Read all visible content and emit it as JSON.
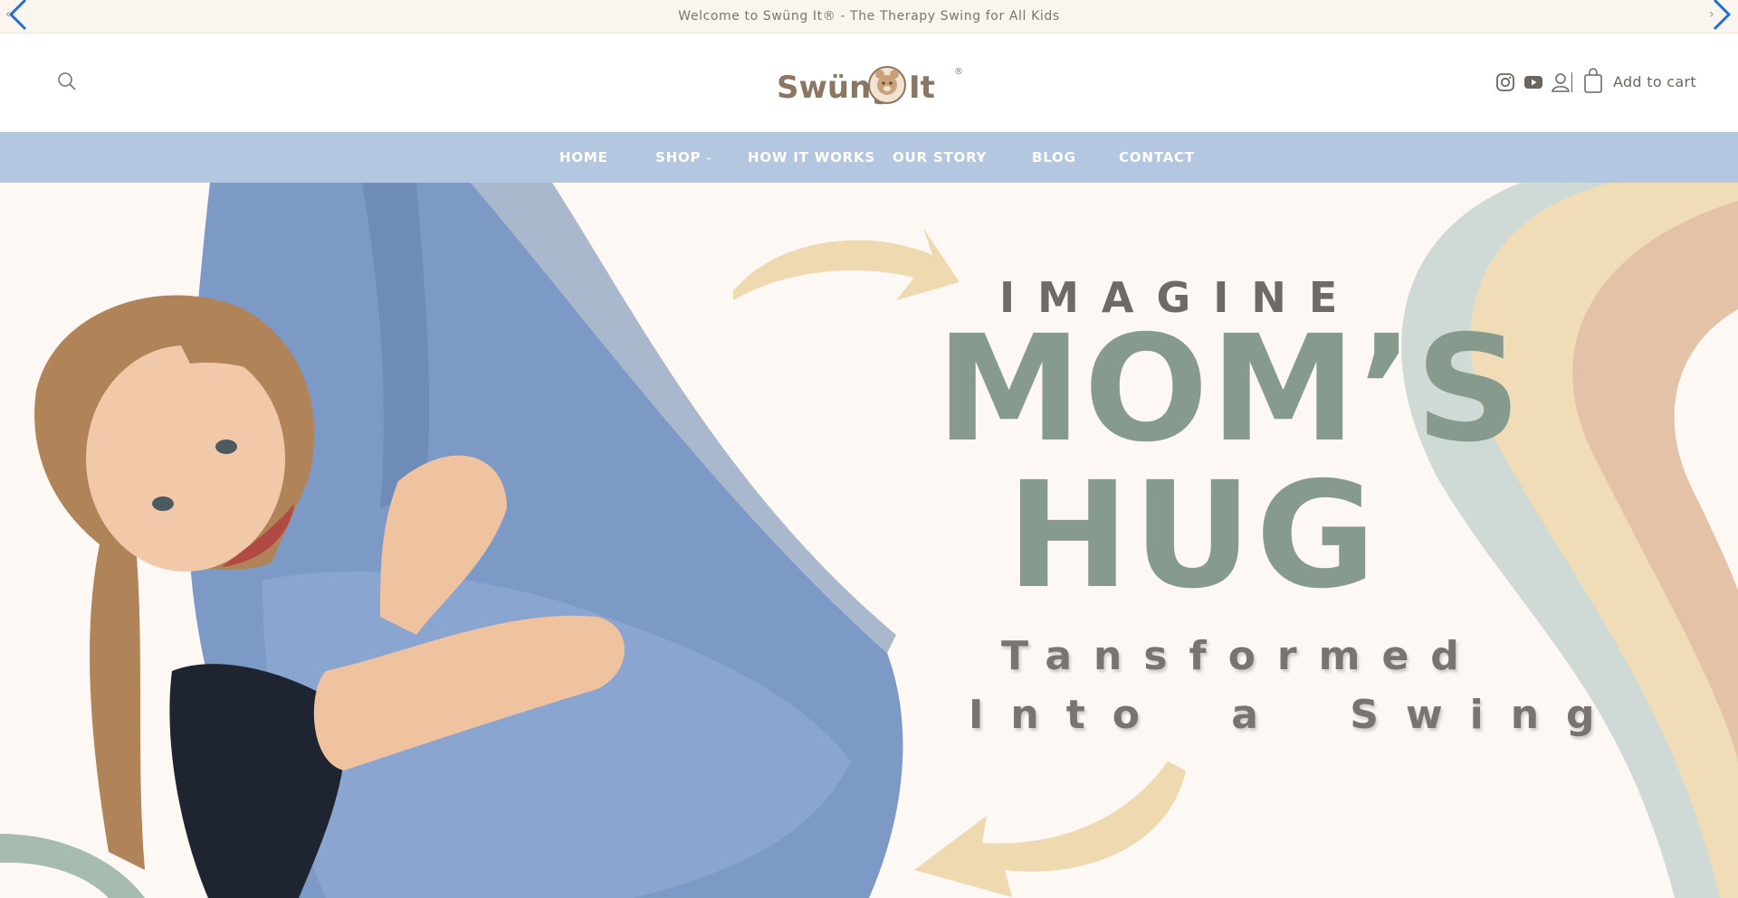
{
  "announcement": {
    "text": "Welcome to Swüng It® - The Therapy Swing for All Kids",
    "prev_icon": "chevron-left-icon",
    "next_icon": "chevron-right-icon"
  },
  "header": {
    "logo_text": "Swüng It",
    "logo_mark": "®",
    "search_icon": "search-icon",
    "social": [
      "instagram-icon",
      "youtube-icon"
    ],
    "account_icon": "user-icon",
    "cart_icon": "shopping-bag-icon",
    "cart_label": "Add to cart"
  },
  "nav": {
    "items": [
      {
        "label": "HOME",
        "dropdown": false
      },
      {
        "label": "SHOP",
        "dropdown": true
      },
      {
        "label": "HOW IT WORKS",
        "dropdown": false
      },
      {
        "label": "OUR STORY",
        "dropdown": true
      },
      {
        "label": "BLOG",
        "dropdown": false
      },
      {
        "label": "CONTACT",
        "dropdown": false
      }
    ],
    "caret": "⌄"
  },
  "hero": {
    "line1": "IMAGINE",
    "line2": "MOM’S",
    "line3": "HUG",
    "line4": "Tansformed",
    "line5": "Into a Swing"
  },
  "colors": {
    "nav_bg": "#b3c7e0",
    "hero_bg": "#fdf8f3",
    "headline_green": "#869b8d",
    "text_gray": "#7a7470",
    "arrow_tan": "#efd9b1"
  }
}
